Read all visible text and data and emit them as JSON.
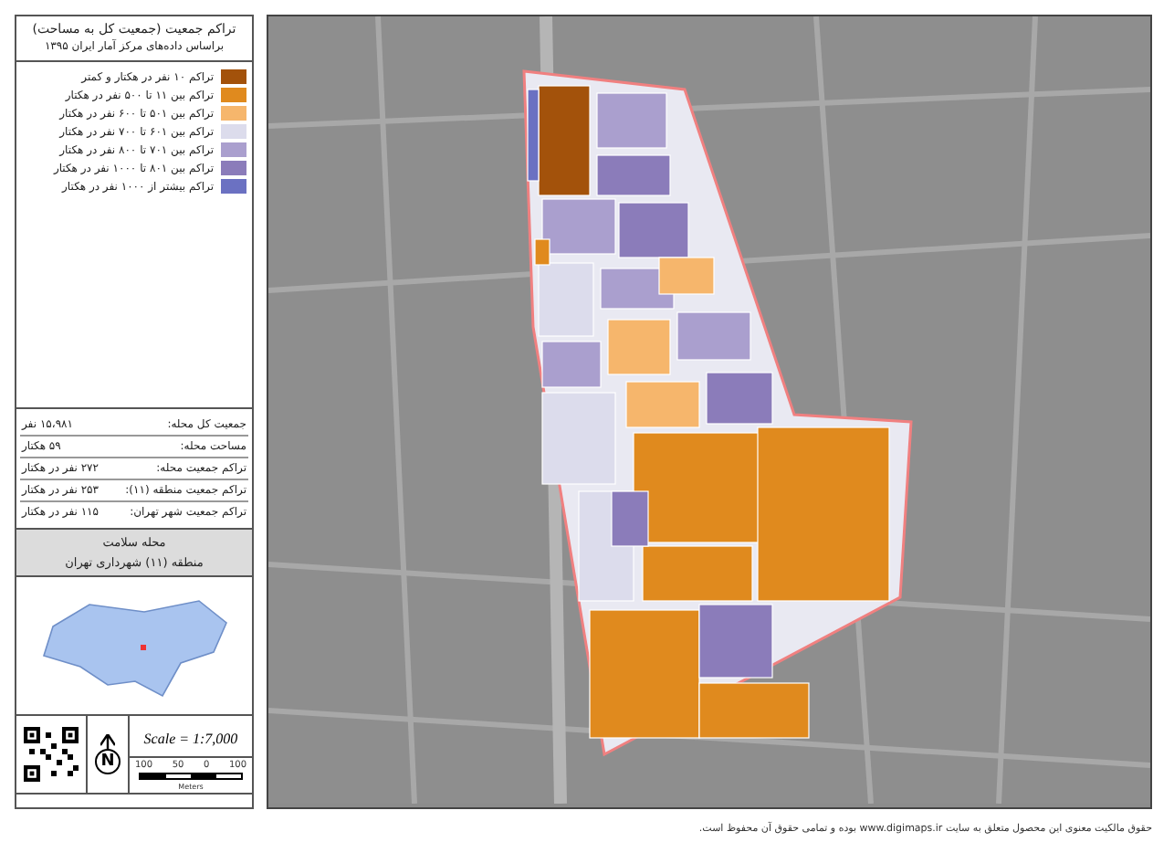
{
  "legend": {
    "title": "تراکم جمعیت (جمعیت کل به مساحت)",
    "subtitle": "براساس داده‌های مرکز آمار ایران ۱۳۹۵",
    "items": [
      {
        "label": "تراکم ۱۰ نفر در هکتار و کمتر",
        "color": "#a3520b"
      },
      {
        "label": "تراکم بین ۱۱ تا ۵۰۰ نفر در هکتار",
        "color": "#e08a1e"
      },
      {
        "label": "تراکم بین ۵۰۱ تا ۶۰۰ نفر در هکتار",
        "color": "#f6b66c"
      },
      {
        "label": "تراکم بین ۶۰۱ تا ۷۰۰ نفر در هکتار",
        "color": "#dcdcec"
      },
      {
        "label": "تراکم بین ۷۰۱ تا ۸۰۰ نفر در هکتار",
        "color": "#aa9fce"
      },
      {
        "label": "تراکم بین ۸۰۱ تا ۱۰۰۰ نفر در هکتار",
        "color": "#8b7cba"
      },
      {
        "label": "تراکم بیشتر از ۱۰۰۰ نفر در هکتار",
        "color": "#6b71c2"
      }
    ]
  },
  "stats": [
    {
      "label": "جمعیت کل محله:",
      "value": "۱۵،۹۸۱ نفر"
    },
    {
      "label": "مساحت محله:",
      "value": "۵۹ هکتار"
    },
    {
      "label": "تراکم جمعیت محله:",
      "value": "۲۷۲ نفر در هکتار"
    },
    {
      "label": "تراکم جمعیت منطقه (۱۱):",
      "value": "۲۵۳ نفر در هکتار"
    },
    {
      "label": "تراکم جمعیت شهر تهران:",
      "value": "۱۱۵ نفر در هکتار"
    }
  ],
  "location": {
    "neighborhood": "محله سلامت",
    "district": "منطقه (۱۱) شهرداری تهران"
  },
  "north": "N",
  "scale": {
    "text": "Scale = 1:7,000",
    "ticks": [
      "100",
      "0",
      "50",
      "100"
    ],
    "unit": "Meters"
  },
  "footer": "حقوق مالکیت معنوی این محصول متعلق به سایت www.digimaps.ir بوده و تمامی حقوق آن محفوظ است."
}
